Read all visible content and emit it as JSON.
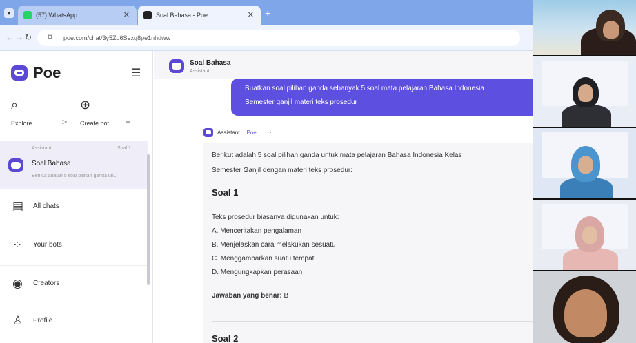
{
  "browser": {
    "tabs": [
      {
        "label": "(57) WhatsApp",
        "favicon_color": "#25d366",
        "active": false
      },
      {
        "label": "Soal Bahasa - Poe",
        "favicon_color": "#222222",
        "active": true
      }
    ],
    "new_tab": "+",
    "url": "poe.com/chat/3y5Zd6Sexg8pe1nhdww"
  },
  "app": {
    "name": "Poe",
    "menu_icon": "hamburger-icon",
    "accent": "#5b49d6"
  },
  "sidebar": {
    "explore_label": "Explore",
    "explore_arrow": ">",
    "create_bot_label": "Create bot",
    "create_bot_plus": "+",
    "active_chat": {
      "meta": "Assistant",
      "count": "Soal 1",
      "title": "Soal Bahasa",
      "preview": "Berikut adalah 5 soal pilihan ganda un..."
    },
    "items": [
      {
        "label": "All chats",
        "icon": "chats-icon"
      },
      {
        "label": "Your bots",
        "icon": "bots-icon"
      },
      {
        "label": "Creators",
        "icon": "creators-icon"
      },
      {
        "label": "Profile",
        "icon": "profile-icon"
      }
    ]
  },
  "chat": {
    "header": {
      "title": "Soal Bahasa",
      "subtitle": "Assistant"
    },
    "user_message": {
      "line1": "Buatkan soal pilihan ganda sebanyak 5 soal mata pelajaran Bahasa Indonesia",
      "line2": "Semester ganjil materi teks prosedur"
    },
    "assistant": {
      "name": "Assistant",
      "badge": "Poe",
      "more": "···",
      "intro1": "Berikut adalah 5 soal pilihan ganda untuk mata pelajaran Bahasa Indonesia Kelas",
      "intro2": "Semester Ganjil dengan materi teks prosedur:",
      "q1_heading": "Soal 1",
      "q1_text": "Teks prosedur biasanya digunakan untuk:",
      "options": [
        "A. Menceritakan pengalaman",
        "B. Menjelaskan cara melakukan sesuatu",
        "C. Menggambarkan suatu tempat",
        "D. Mengungkapkan perasaan"
      ],
      "answer_label": "Jawaban yang benar:",
      "answer_value": "B",
      "next_heading": "Soal 2"
    }
  }
}
